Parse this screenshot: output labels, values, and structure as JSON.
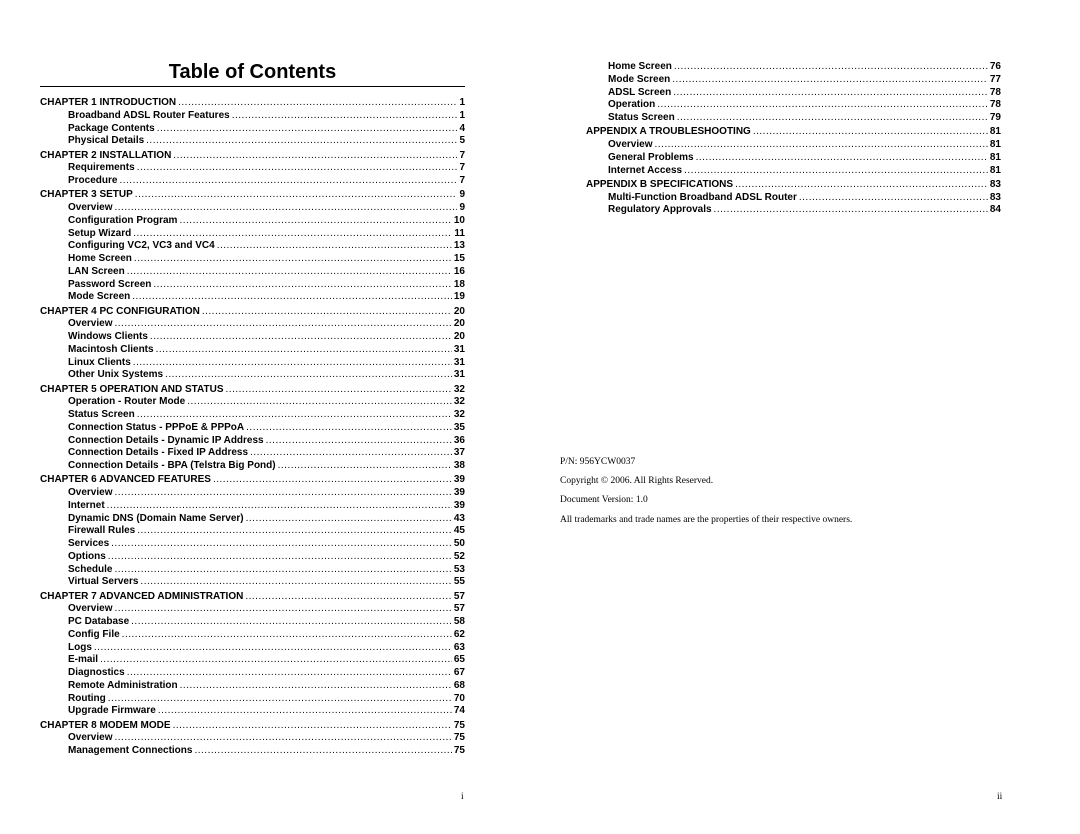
{
  "title": "Table of Contents",
  "left_toc": [
    {
      "type": "chap",
      "label": "CHAPTER 1 INTRODUCTION",
      "page": "1"
    },
    {
      "type": "sub",
      "label": "Broadband ADSL Router Features",
      "page": "1"
    },
    {
      "type": "sub",
      "label": "Package Contents",
      "page": "4"
    },
    {
      "type": "sub",
      "label": "Physical Details",
      "page": "5"
    },
    {
      "type": "chap",
      "label": "CHAPTER 2 INSTALLATION",
      "page": "7"
    },
    {
      "type": "sub",
      "label": "Requirements",
      "page": "7"
    },
    {
      "type": "sub",
      "label": "Procedure",
      "page": "7"
    },
    {
      "type": "chap",
      "label": "CHAPTER 3 SETUP",
      "page": "9"
    },
    {
      "type": "sub",
      "label": "Overview",
      "page": "9"
    },
    {
      "type": "sub",
      "label": "Configuration Program",
      "page": "10"
    },
    {
      "type": "sub",
      "label": "Setup Wizard",
      "page": "11"
    },
    {
      "type": "sub",
      "label": "Configuring VC2, VC3 and VC4",
      "page": "13"
    },
    {
      "type": "sub",
      "label": "Home Screen",
      "page": "15"
    },
    {
      "type": "sub",
      "label": "LAN Screen",
      "page": "16"
    },
    {
      "type": "sub",
      "label": "Password Screen",
      "page": "18"
    },
    {
      "type": "sub",
      "label": "Mode Screen",
      "page": "19"
    },
    {
      "type": "chap",
      "label": "CHAPTER 4 PC CONFIGURATION",
      "page": "20"
    },
    {
      "type": "sub",
      "label": "Overview",
      "page": "20"
    },
    {
      "type": "sub",
      "label": "Windows Clients",
      "page": "20"
    },
    {
      "type": "sub",
      "label": "Macintosh Clients",
      "page": "31"
    },
    {
      "type": "sub",
      "label": "Linux Clients",
      "page": "31"
    },
    {
      "type": "sub",
      "label": "Other Unix Systems",
      "page": "31"
    },
    {
      "type": "chap",
      "label": "CHAPTER 5 OPERATION AND STATUS",
      "page": "32"
    },
    {
      "type": "sub",
      "label": "Operation - Router Mode",
      "page": "32"
    },
    {
      "type": "sub",
      "label": "Status Screen",
      "page": "32"
    },
    {
      "type": "sub",
      "label": "Connection Status - PPPoE & PPPoA",
      "page": "35"
    },
    {
      "type": "sub",
      "label": "Connection Details - Dynamic IP Address",
      "page": "36"
    },
    {
      "type": "sub",
      "label": "Connection Details - Fixed IP Address",
      "page": "37"
    },
    {
      "type": "sub",
      "label": "Connection Details - BPA (Telstra Big Pond)",
      "page": "38"
    },
    {
      "type": "chap",
      "label": "CHAPTER 6 ADVANCED FEATURES",
      "page": "39"
    },
    {
      "type": "sub",
      "label": "Overview",
      "page": "39"
    },
    {
      "type": "sub",
      "label": "Internet",
      "page": "39"
    },
    {
      "type": "sub",
      "label": "Dynamic DNS (Domain Name Server)",
      "page": "43"
    },
    {
      "type": "sub",
      "label": "Firewall Rules",
      "page": "45"
    },
    {
      "type": "sub",
      "label": "Services",
      "page": "50"
    },
    {
      "type": "sub",
      "label": "Options",
      "page": "52"
    },
    {
      "type": "sub",
      "label": "Schedule",
      "page": "53"
    },
    {
      "type": "sub",
      "label": "Virtual Servers",
      "page": "55"
    },
    {
      "type": "chap",
      "label": "CHAPTER 7 ADVANCED ADMINISTRATION",
      "page": "57"
    },
    {
      "type": "sub",
      "label": "Overview",
      "page": "57"
    },
    {
      "type": "sub",
      "label": "PC Database",
      "page": "58"
    },
    {
      "type": "sub",
      "label": "Config File",
      "page": "62"
    },
    {
      "type": "sub",
      "label": "Logs",
      "page": "63"
    },
    {
      "type": "sub",
      "label": "E-mail",
      "page": "65"
    },
    {
      "type": "sub",
      "label": "Diagnostics",
      "page": "67"
    },
    {
      "type": "sub",
      "label": "Remote Administration",
      "page": "68"
    },
    {
      "type": "sub",
      "label": "Routing",
      "page": "70"
    },
    {
      "type": "sub",
      "label": "Upgrade Firmware",
      "page": "74"
    },
    {
      "type": "chap",
      "label": "CHAPTER 8 MODEM MODE",
      "page": "75"
    },
    {
      "type": "sub",
      "label": "Overview",
      "page": "75"
    },
    {
      "type": "sub",
      "label": "Management Connections",
      "page": "75"
    }
  ],
  "right_toc": [
    {
      "type": "sub",
      "label": "Home Screen",
      "page": "76"
    },
    {
      "type": "sub",
      "label": "Mode Screen",
      "page": "77"
    },
    {
      "type": "sub",
      "label": "ADSL Screen",
      "page": "78"
    },
    {
      "type": "sub",
      "label": "Operation",
      "page": "78"
    },
    {
      "type": "sub",
      "label": "Status Screen",
      "page": "79"
    },
    {
      "type": "chap",
      "label": "APPENDIX A TROUBLESHOOTING",
      "page": "81"
    },
    {
      "type": "sub",
      "label": "Overview",
      "page": "81"
    },
    {
      "type": "sub",
      "label": "General Problems",
      "page": "81"
    },
    {
      "type": "sub",
      "label": "Internet Access",
      "page": "81"
    },
    {
      "type": "chap",
      "label": "APPENDIX B SPECIFICATIONS",
      "page": "83"
    },
    {
      "type": "sub",
      "label": "Multi-Function Broadband ADSL Router",
      "page": "83"
    },
    {
      "type": "sub",
      "label": "Regulatory Approvals",
      "page": "84"
    }
  ],
  "info": {
    "part_number": "P/N: 956YCW0037",
    "copyright": "Copyright © 2006. All Rights Reserved.",
    "version": "Document Version: 1.0",
    "trademarks": "All trademarks and trade names are the properties of their respective owners."
  },
  "page_numbers": {
    "left": "i",
    "right": "ii"
  }
}
